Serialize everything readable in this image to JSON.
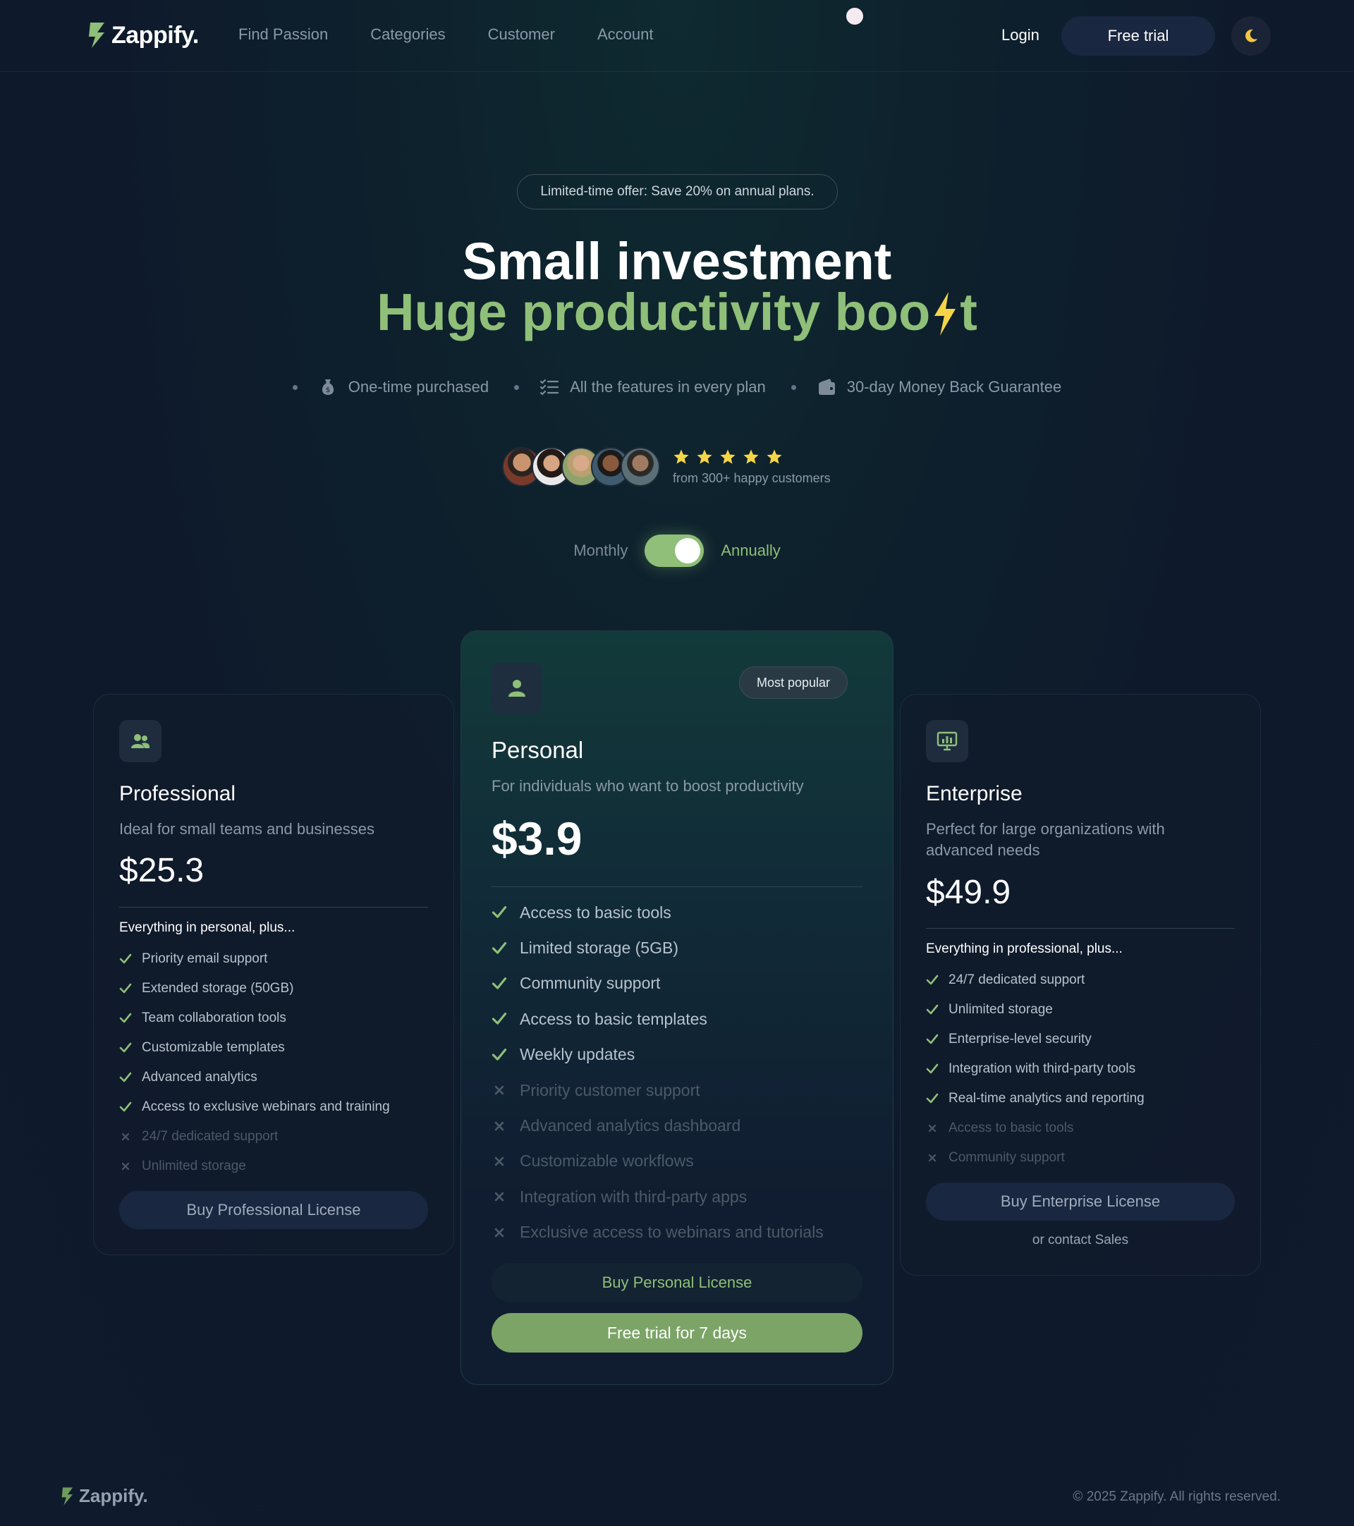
{
  "nav": {
    "logo": "Zappify.",
    "links": [
      "Find Passion",
      "Categories",
      "Customer",
      "Account"
    ],
    "login": "Login",
    "free_trial": "Free trial"
  },
  "hero": {
    "offer": "Limited-time offer: Save 20% on annual plans.",
    "title_line1": "Small investment",
    "title_line2_pre": "Huge productivity boo",
    "title_line2_post": "t",
    "features": [
      "One-time purchased",
      "All the features in every plan",
      "30-day Money Back Guarantee"
    ],
    "rating_stars": 5,
    "social_caption": "from 300+ happy customers"
  },
  "billing": {
    "monthly": "Monthly",
    "annually": "Annually",
    "selected": "Annually"
  },
  "plans": {
    "professional": {
      "name": "Professional",
      "desc": "Ideal for small teams and businesses",
      "price": "$25.3",
      "plus_title": "Everything in personal, plus...",
      "included": [
        "Priority email support",
        "Extended storage (50GB)",
        "Team collaboration tools",
        "Customizable templates",
        "Advanced analytics",
        "Access to exclusive webinars and training"
      ],
      "excluded": [
        "24/7 dedicated support",
        "Unlimited storage"
      ],
      "button": "Buy Professional License"
    },
    "personal": {
      "badge": "Most popular",
      "name": "Personal",
      "desc": "For individuals who want to boost productivity",
      "price": "$3.9",
      "included": [
        "Access to basic tools",
        "Limited storage (5GB)",
        "Community support",
        "Access to basic templates",
        "Weekly updates"
      ],
      "excluded": [
        "Priority customer support",
        "Advanced analytics dashboard",
        "Customizable workflows",
        "Integration with third-party apps",
        "Exclusive access to webinars and tutorials"
      ],
      "button": "Buy Personal License",
      "trial_button": "Free trial for 7 days"
    },
    "enterprise": {
      "name": "Enterprise",
      "desc_line1": "Perfect for large organizations with",
      "desc_line2": "advanced needs",
      "price": "$49.9",
      "plus_title": "Everything in professional, plus...",
      "included": [
        "24/7 dedicated support",
        "Unlimited storage",
        "Enterprise-level security",
        "Integration with third-party tools",
        "Real-time analytics and reporting"
      ],
      "excluded": [
        "Access to basic tools",
        "Community support"
      ],
      "button": "Buy Enterprise License",
      "contact": "or contact Sales"
    }
  },
  "footer": {
    "logo": "Zappify.",
    "copyright": "© 2025 Zappify. All rights reserved."
  },
  "colors": {
    "accent": "#8fbf78",
    "background": "#0e1a2c",
    "star": "#f5d547",
    "bolt": "#f5d547"
  },
  "icons": [
    "zappify-logo-icon",
    "money-bag-icon",
    "checklist-icon",
    "wallet-icon",
    "star-icon",
    "users-icon",
    "user-icon",
    "monitor-chart-icon",
    "check-icon",
    "x-icon",
    "moon-icon",
    "bolt-icon"
  ]
}
